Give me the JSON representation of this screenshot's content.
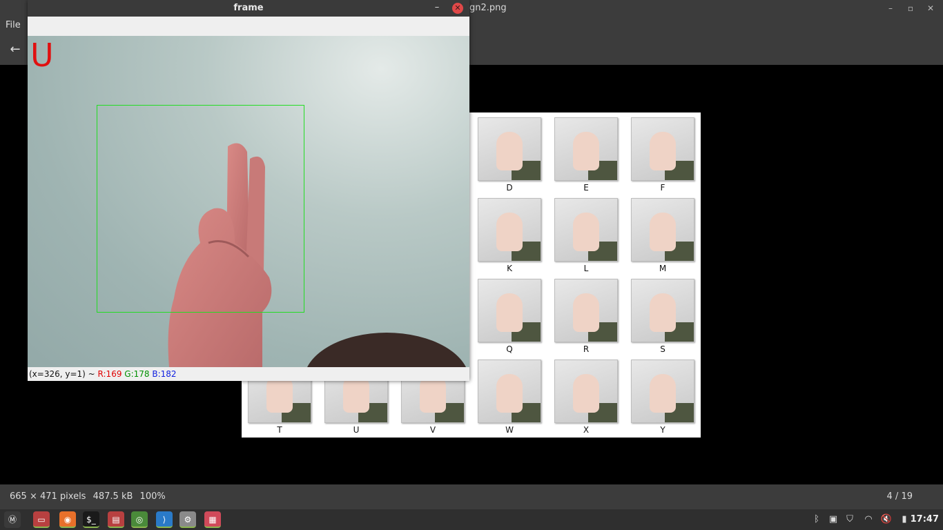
{
  "viewer": {
    "title": "gn2.png",
    "menu_file": "File",
    "back_icon": "arrow-left-icon",
    "status": {
      "dimensions": "665 × 471 pixels",
      "filesize": "487.5 kB",
      "zoom": "100%",
      "position": "4 / 19"
    }
  },
  "asl_chart": {
    "signs": [
      {
        "label": "D"
      },
      {
        "label": "E"
      },
      {
        "label": "F"
      },
      {
        "label": "K"
      },
      {
        "label": "L"
      },
      {
        "label": "M"
      },
      {
        "label": "Q"
      },
      {
        "label": "R"
      },
      {
        "label": "S"
      },
      {
        "label": "T"
      },
      {
        "label": "U"
      },
      {
        "label": "V"
      },
      {
        "label": "W"
      },
      {
        "label": "X"
      },
      {
        "label": "Y"
      }
    ]
  },
  "frame": {
    "title": "frame",
    "predicted_letter": "U",
    "status": {
      "coords": "(x=326, y=1) ~",
      "r": "R:169",
      "g": "G:178",
      "b": "B:182"
    },
    "colors": {
      "roi_box": "#22dd22",
      "prediction": "#e01010"
    }
  },
  "taskbar": {
    "apps": [
      {
        "name": "mint-menu-icon"
      },
      {
        "name": "show-desktop-icon"
      },
      {
        "name": "firefox-icon"
      },
      {
        "name": "terminal-icon"
      },
      {
        "name": "files-icon"
      },
      {
        "name": "chrome-icon"
      },
      {
        "name": "vscode-icon"
      },
      {
        "name": "settings-icon"
      },
      {
        "name": "image-viewer-icon"
      }
    ],
    "tray": [
      "bluetooth-icon",
      "clipboard-icon",
      "shield-icon",
      "wifi-icon",
      "volume-muted-icon",
      "battery-icon"
    ],
    "clock": "17:47"
  }
}
